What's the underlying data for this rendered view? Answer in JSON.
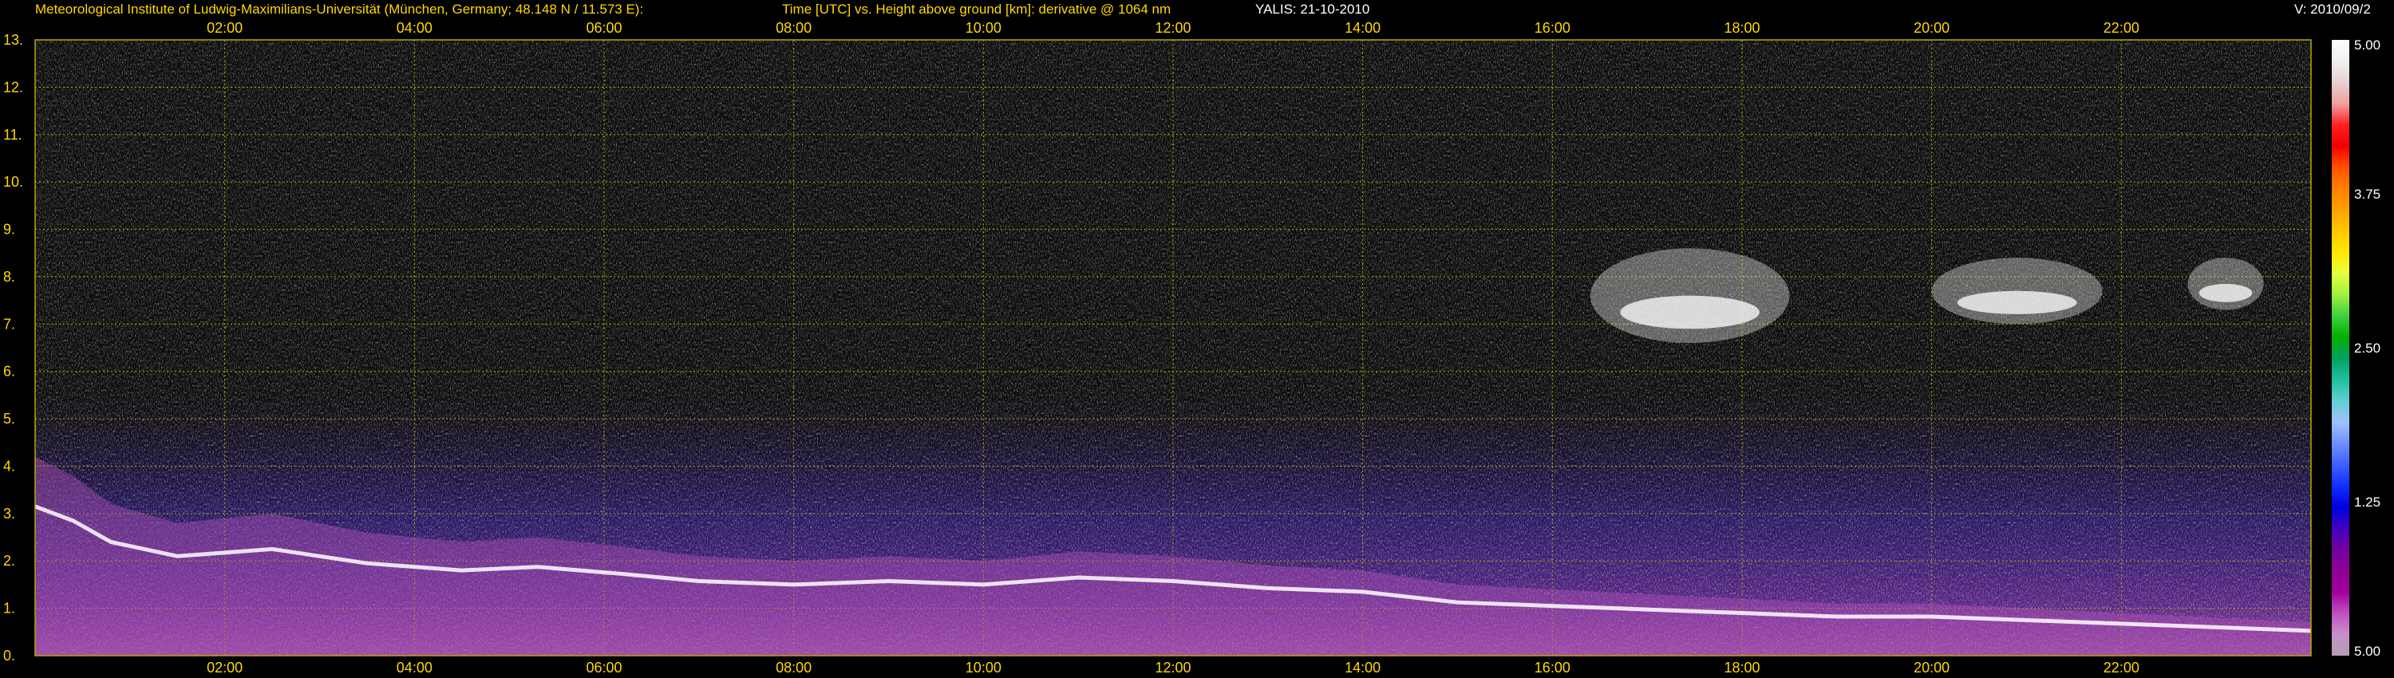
{
  "header": {
    "institute": "Meteorological Institute of Ludwig-Maximilians-Universität (München, Germany; 48.148 N / 11.573 E):",
    "plot_description": "Time [UTC] vs. Height above ground [km]: derivative @ 1064 nm",
    "instrument_date": "YALIS: 21-10-2010",
    "version": "V: 2010/09/2"
  },
  "colors": {
    "label_yellow": "#ffd800",
    "grid_yellow": "#b8a800",
    "background": "#000000"
  },
  "chart_data": {
    "type": "heatmap",
    "x_unit": "UTC hour",
    "y_unit": "km",
    "xlim": [
      0,
      24
    ],
    "ylim": [
      0,
      13
    ],
    "x_ticks": [
      2,
      4,
      6,
      8,
      10,
      12,
      14,
      16,
      18,
      20,
      22
    ],
    "x_tick_labels": [
      "02:00",
      "04:00",
      "06:00",
      "08:00",
      "10:00",
      "12:00",
      "14:00",
      "16:00",
      "18:00",
      "20:00",
      "22:00"
    ],
    "y_ticks": [
      0,
      1,
      2,
      3,
      4,
      5,
      6,
      7,
      8,
      9,
      10,
      11,
      12,
      13
    ],
    "y_tick_labels": [
      "0.",
      "1.",
      "2.",
      "3.",
      "4.",
      "5.",
      "6.",
      "7.",
      "8.",
      "9.",
      "10.",
      "11.",
      "12.",
      "13."
    ],
    "grid": true,
    "colorbar": {
      "ticks": [
        5.0,
        3.75,
        2.5,
        1.25,
        5.0
      ],
      "tick_labels": [
        "5.00",
        "3.75",
        "2.50",
        "1.25",
        "5.00"
      ],
      "colors": [
        "#ffffff",
        "#f0f0f0",
        "#e8d0d0",
        "#f0a0a0",
        "#ff2020",
        "#f00000",
        "#ff5000",
        "#ff8000",
        "#ffa000",
        "#ffc800",
        "#ffe800",
        "#e8ff40",
        "#a0f040",
        "#40d040",
        "#00b000",
        "#00a060",
        "#20c0a0",
        "#60d0d0",
        "#a0c0ff",
        "#7090ff",
        "#4060ff",
        "#1030ff",
        "#0000e0",
        "#4000c0",
        "#7000a0",
        "#900090",
        "#a000a0",
        "#c050c0",
        "#c890c8",
        "#b0a0b0"
      ]
    },
    "features": [
      {
        "type": "boundary_layer",
        "t": [
          0.0,
          0.4,
          0.8,
          1.5,
          2.5,
          3.5,
          4.5,
          5.3,
          6.2,
          7.0,
          8.0,
          9.0,
          10.0,
          11.0,
          12.0,
          13.0,
          14.0,
          15.0,
          16.0,
          17.0,
          18.0,
          19.0,
          20.0,
          21.0,
          22.0,
          23.0,
          24.0
        ],
        "top_km": [
          4.2,
          3.8,
          3.2,
          2.8,
          3.0,
          2.6,
          2.4,
          2.5,
          2.3,
          2.1,
          2.0,
          2.1,
          2.0,
          2.2,
          2.1,
          1.9,
          1.8,
          1.5,
          1.4,
          1.3,
          1.2,
          1.1,
          1.1,
          1.0,
          0.9,
          0.8,
          0.7
        ]
      },
      {
        "type": "cirrus",
        "t_start": 16.4,
        "t_end": 18.5,
        "base_km": 6.6,
        "top_km": 8.6
      },
      {
        "type": "cirrus",
        "t_start": 20.0,
        "t_end": 21.8,
        "base_km": 7.0,
        "top_km": 8.4
      },
      {
        "type": "cirrus",
        "t_start": 22.7,
        "t_end": 23.5,
        "base_km": 7.3,
        "top_km": 8.4
      }
    ]
  }
}
